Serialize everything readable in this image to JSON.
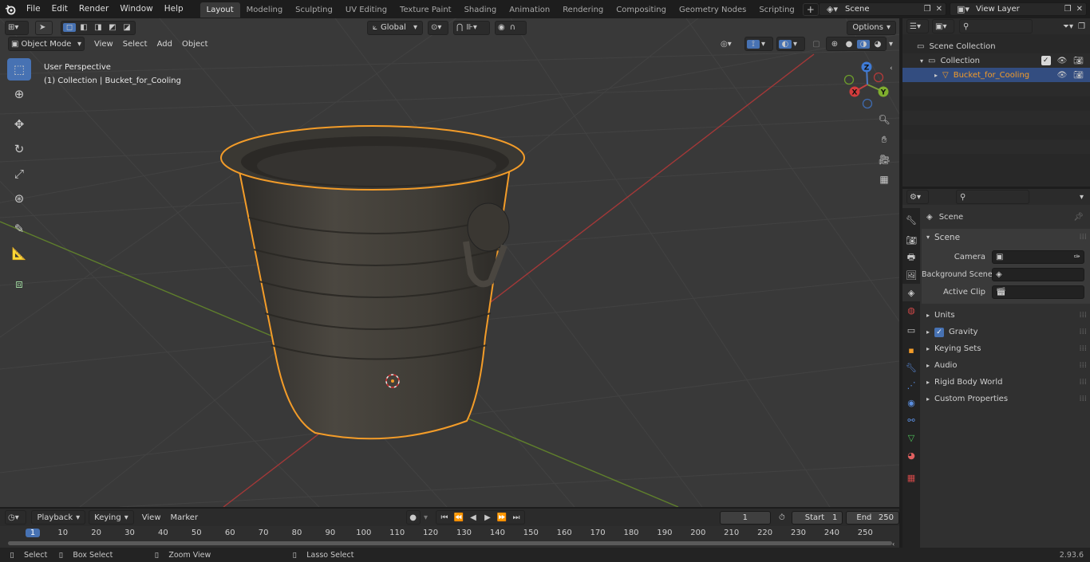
{
  "top_menu": {
    "logo": "blender-logo-icon",
    "items": [
      "File",
      "Edit",
      "Render",
      "Window",
      "Help"
    ]
  },
  "workspaces": [
    "Layout",
    "Modeling",
    "Sculpting",
    "UV Editing",
    "Texture Paint",
    "Shading",
    "Animation",
    "Rendering",
    "Compositing",
    "Geometry Nodes",
    "Scripting"
  ],
  "active_workspace": "Layout",
  "scene_selector": {
    "value": "Scene"
  },
  "view_layer_selector": {
    "value": "View Layer"
  },
  "viewport_header": {
    "mode": "Object Mode",
    "menus": [
      "View",
      "Select",
      "Add",
      "Object"
    ],
    "transform_orientation": "Global",
    "options_label": "Options"
  },
  "viewport_overlay": {
    "line1": "User Perspective",
    "line2": "(1) Collection | Bucket_for_Cooling"
  },
  "gizmo": {
    "x": "X",
    "y": "Y",
    "z": "Z"
  },
  "outliner": {
    "search_placeholder": "",
    "rows": [
      {
        "label": "Scene Collection",
        "level": 0
      },
      {
        "label": "Collection",
        "level": 1
      },
      {
        "label": "Bucket_for_Cooling",
        "level": 2,
        "selected": true
      }
    ]
  },
  "properties": {
    "context_label": "Scene",
    "panel_title": "Scene",
    "fields": [
      {
        "label": "Camera",
        "value": ""
      },
      {
        "label": "Background Scene",
        "value": ""
      },
      {
        "label": "Active Clip",
        "value": ""
      }
    ],
    "collapsed_panels": [
      "Units",
      "Gravity",
      "Keying Sets",
      "Audio",
      "Rigid Body World",
      "Custom Properties"
    ],
    "gravity_checked": true
  },
  "timeline": {
    "menus": [
      "Playback",
      "Keying",
      "View",
      "Marker"
    ],
    "current_frame": "1",
    "start_label": "Start",
    "start_value": "1",
    "end_label": "End",
    "end_value": "250",
    "ruler_labels": [
      "1",
      "10",
      "20",
      "30",
      "40",
      "50",
      "60",
      "70",
      "80",
      "90",
      "100",
      "110",
      "120",
      "130",
      "140",
      "150",
      "160",
      "170",
      "180",
      "190",
      "200",
      "210",
      "220",
      "230",
      "240",
      "250"
    ]
  },
  "statusbar": {
    "items": [
      "Select",
      "Box Select",
      "Zoom View",
      "Lasso Select"
    ],
    "version": "2.93.6"
  },
  "colors": {
    "selection_outline": "#f39c29",
    "header_active": "#4772b3",
    "grid_bg": "#393939",
    "x_axis": "#b33a3a",
    "y_axis": "#6b9b2b"
  }
}
